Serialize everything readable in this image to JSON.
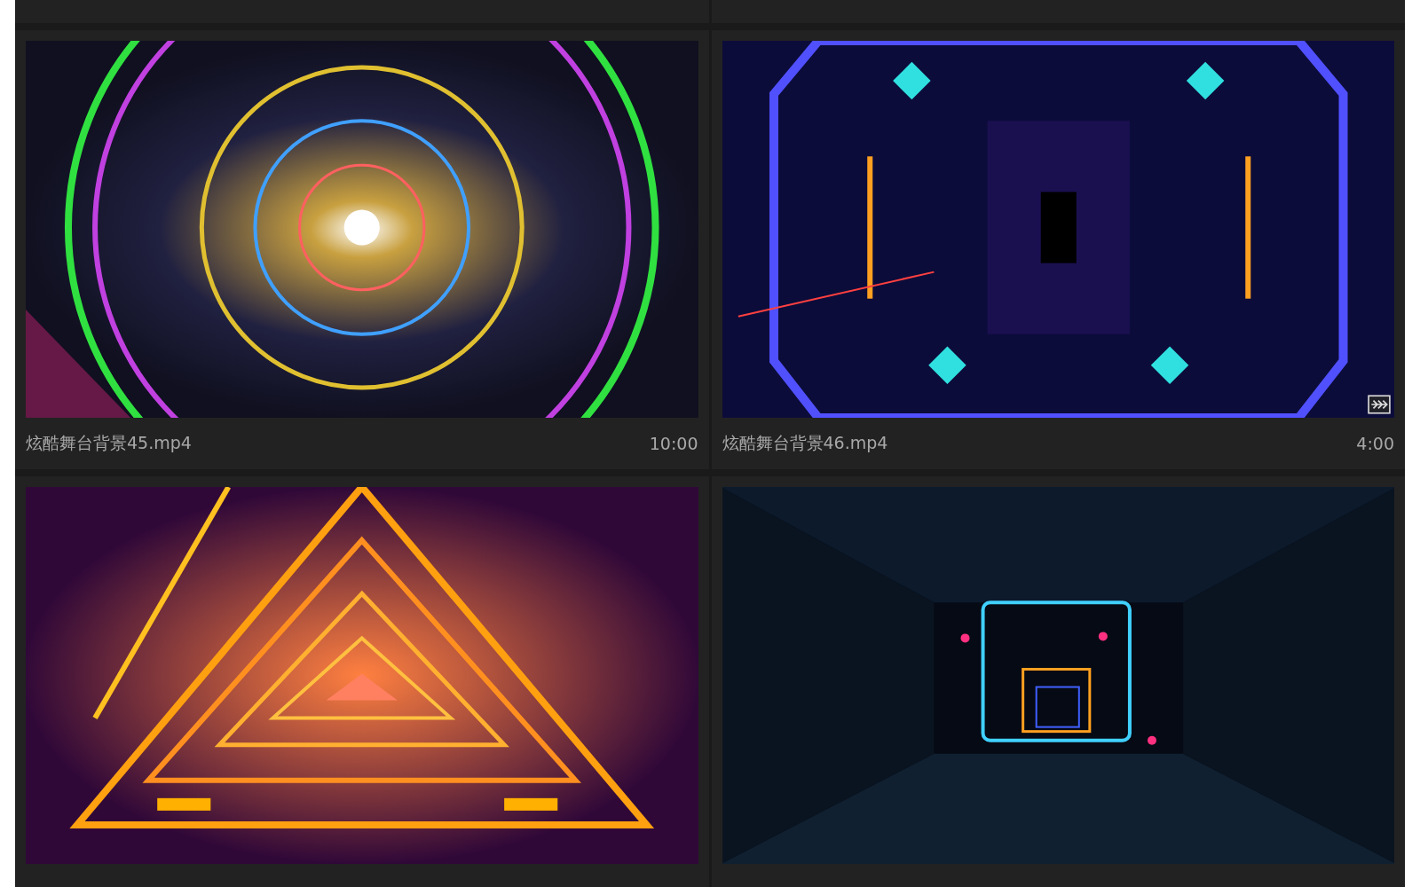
{
  "items": [
    {
      "title": "炫酷舞台背景45.mp4",
      "duration": "10:00",
      "thumbnail": {
        "kind": "picture",
        "badge": false
      }
    },
    {
      "title": "炫酷舞台背景46.mp4",
      "duration": "4:00",
      "thumbnail": {
        "kind": "picture",
        "badge": true
      }
    },
    {
      "thumbnail": {
        "kind": "picture",
        "badge": false
      }
    },
    {
      "thumbnail": {
        "kind": "picture",
        "badge": false
      }
    }
  ]
}
